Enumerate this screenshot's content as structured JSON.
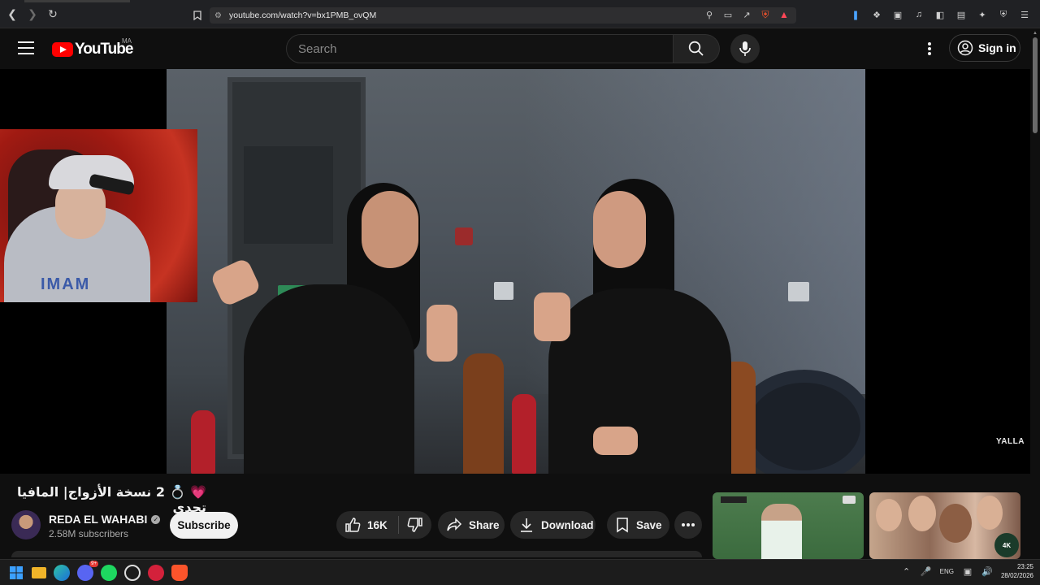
{
  "browser": {
    "url": "youtube.com/watch?v=bx1PMB_ovQM"
  },
  "header": {
    "logo_text": "YouTube",
    "country_code": "MA",
    "search_placeholder": "Search",
    "signin_label": "Sign in"
  },
  "video": {
    "watermark": "YALLA",
    "webcam_text": "IMAM"
  },
  "info": {
    "title": "💗 💍 2 نسخة الأزواج| المافيا تحدي",
    "channel_name": "REDA EL WAHABI",
    "subscribers": "2.58M subscribers",
    "subscribe_label": "Subscribe",
    "likes": "16K",
    "share_label": "Share",
    "download_label": "Download",
    "save_label": "Save"
  },
  "recommendations": [
    {
      "badge": ""
    },
    {
      "badge": "4K"
    }
  ],
  "taskbar": {
    "discord_badge": "9+",
    "language": "ENG",
    "time": "23:25",
    "date": "28/02/2026"
  },
  "colors": {
    "youtube_red": "#ff0000",
    "background": "#0f0f0f"
  }
}
